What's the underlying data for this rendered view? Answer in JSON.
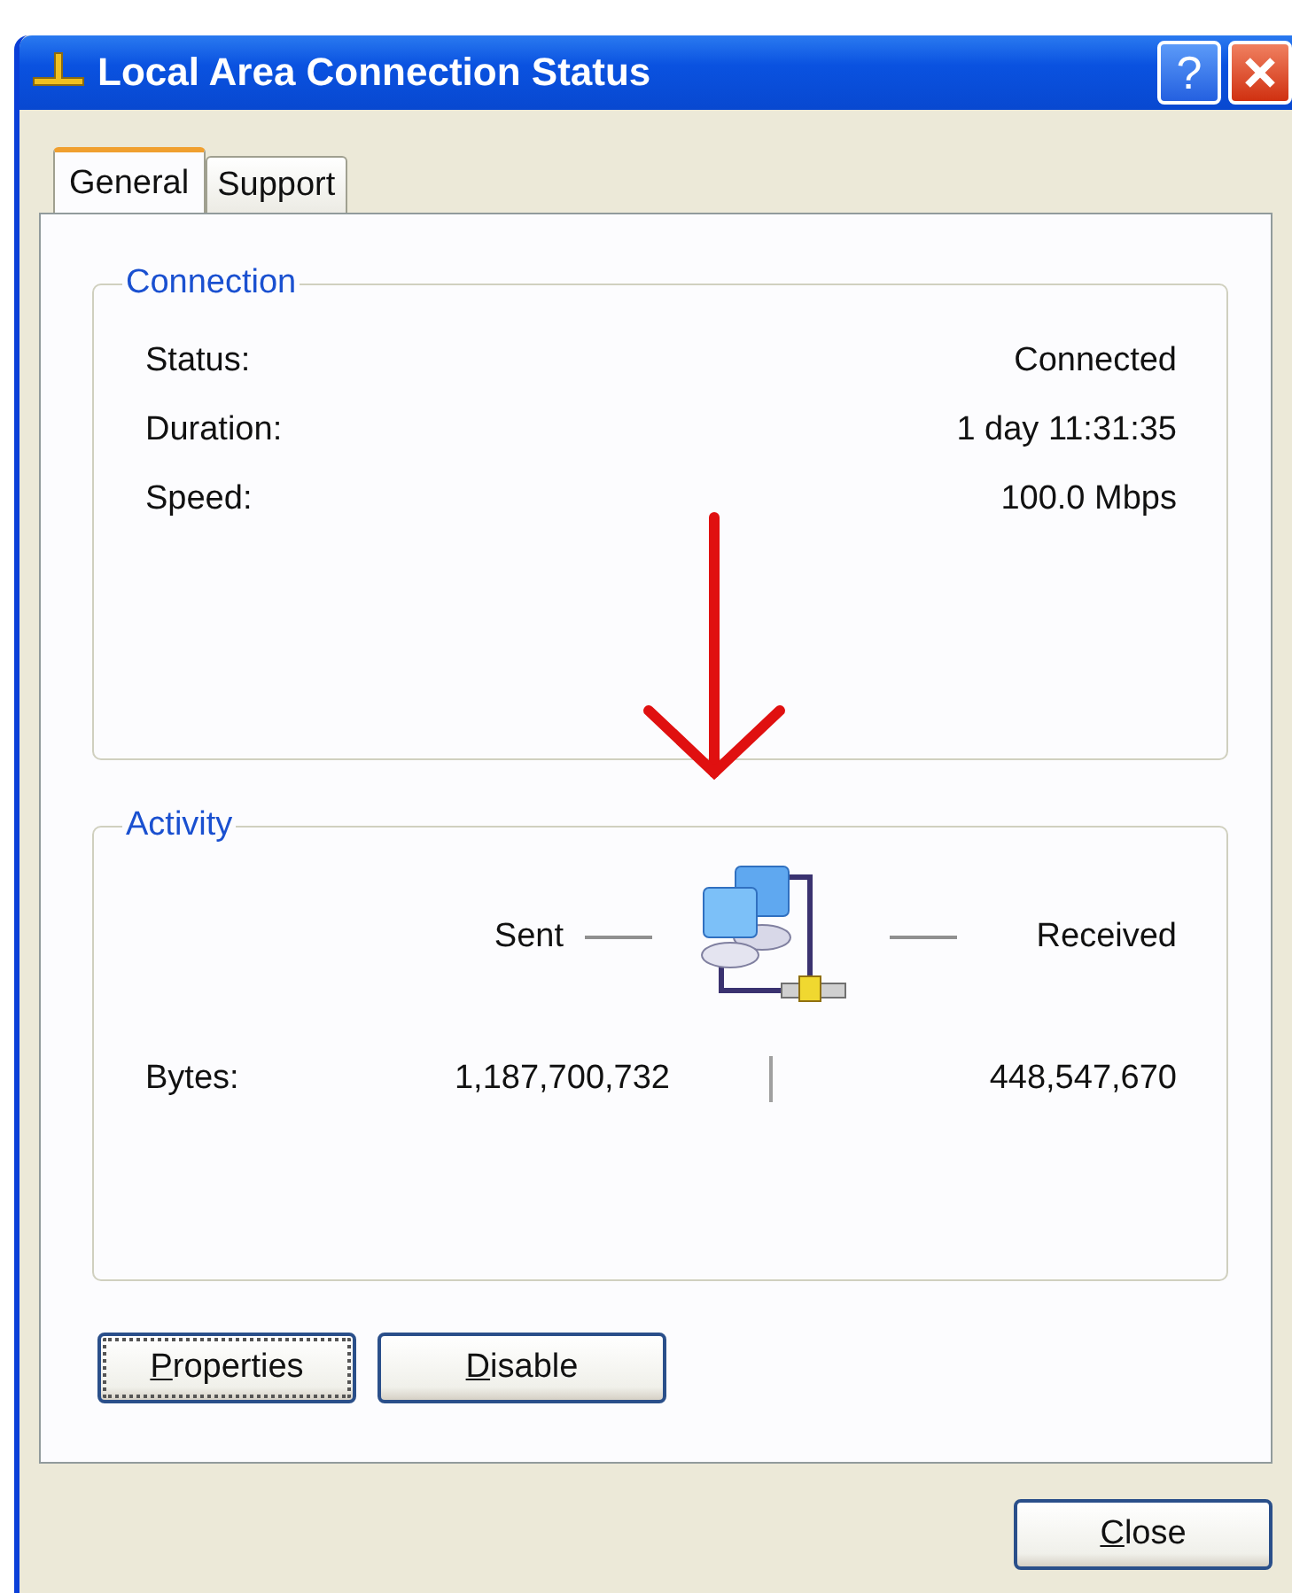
{
  "window": {
    "title": "Local Area Connection Status",
    "help_glyph": "?"
  },
  "tabs": [
    {
      "label": "General",
      "selected": true
    },
    {
      "label": "Support",
      "selected": false
    }
  ],
  "connection": {
    "title": "Connection",
    "rows": [
      {
        "label": "Status:",
        "value": "Connected"
      },
      {
        "label": "Duration:",
        "value": "1 day 11:31:35"
      },
      {
        "label": "Speed:",
        "value": "100.0 Mbps"
      }
    ]
  },
  "activity": {
    "title": "Activity",
    "sent_label": "Sent",
    "received_label": "Received",
    "bytes_label": "Bytes:",
    "bytes_sent": "1,187,700,732",
    "bytes_received": "448,547,670"
  },
  "buttons": [
    {
      "mnemonic": "P",
      "rest": "roperties",
      "focused": true
    },
    {
      "mnemonic": "D",
      "rest": "isable",
      "focused": false
    }
  ],
  "close_button": {
    "mnemonic": "C",
    "rest": "lose"
  }
}
